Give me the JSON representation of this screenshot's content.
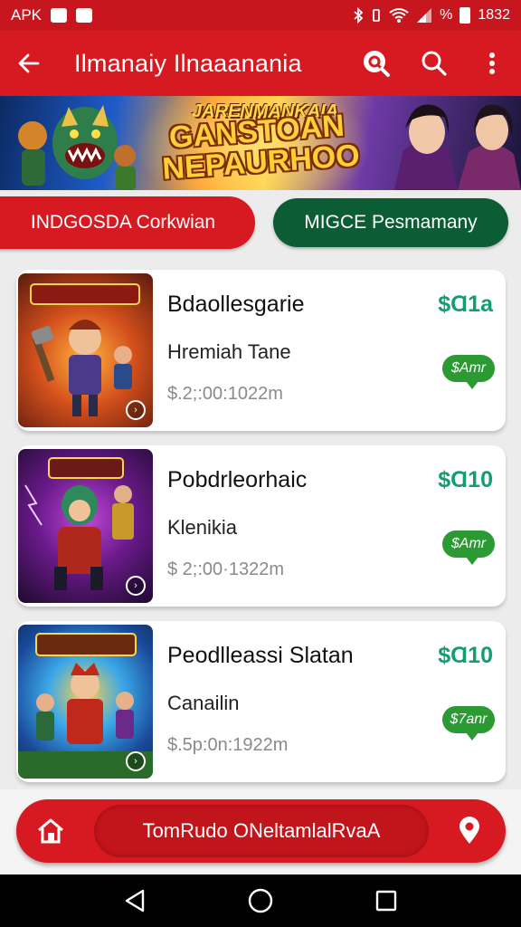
{
  "status": {
    "left_label": "APK",
    "battery_percent_label": "%",
    "time": "1832"
  },
  "app_bar": {
    "title": "Ilmanaiy Ilnaaanania"
  },
  "banner": {
    "subtitle": "JARENMANKAIA",
    "headline_line1": "GANSTOAN",
    "headline_line2": "NEPAURHOO"
  },
  "filters": {
    "primary_label": "INDGOSDA Corkwian",
    "secondary_label": "MIGCE Pesmamany"
  },
  "items": [
    {
      "name": "Bdaollesgarie",
      "subtitle": "Hremiah Tane",
      "time": "$.2;:00:1022m",
      "price": "$Ɑ1a",
      "tag": "$Amr"
    },
    {
      "name": "Pobdrleorhaic",
      "subtitle": "Klenikia",
      "time": "$ 2;:00·1322m",
      "price": "$Ɑ10",
      "tag": "$Amr"
    },
    {
      "name": "Peodlleassi Slatan",
      "subtitle": "Canailin",
      "time": "$.5p:0n:1922m",
      "price": "$Ɑ10",
      "tag": "$7anr"
    }
  ],
  "bottom_bar": {
    "center_label": "TomRudo ONeltamlalRvaA"
  },
  "colors": {
    "primary_red": "#d71a21",
    "dark_green": "#0c5c34",
    "price_green": "#119e72",
    "tag_green": "#2b9a32"
  },
  "icons": [
    "back-arrow-icon",
    "search-badge-icon",
    "search-icon",
    "more-vert-icon",
    "home-icon",
    "location-pin-icon",
    "nav-back-icon",
    "nav-home-icon",
    "nav-recents-icon"
  ]
}
